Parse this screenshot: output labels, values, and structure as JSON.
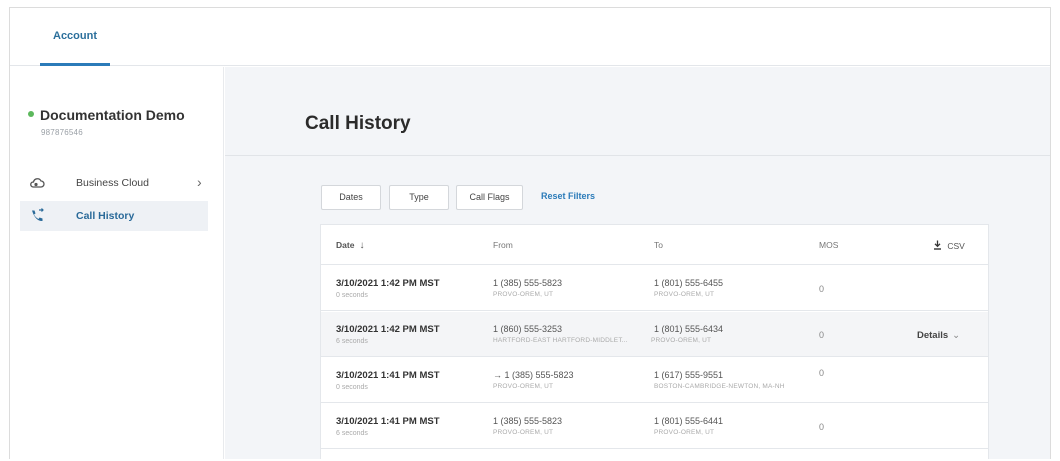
{
  "top_nav": {
    "tab_account": "Account"
  },
  "sidebar": {
    "account_name": "Documentation Demo",
    "account_id": "987876546",
    "items": [
      {
        "label": "Business Cloud",
        "icon": "cloud-icon",
        "chevron": "›"
      },
      {
        "label": "Call History",
        "icon": "phone-call-icon"
      }
    ]
  },
  "main": {
    "title": "Call History",
    "filters": {
      "dates": "Dates",
      "type": "Type",
      "call_flags": "Call Flags",
      "reset": "Reset Filters"
    },
    "table": {
      "headers": {
        "date": "Date",
        "from": "From",
        "to": "To",
        "mos": "MOS",
        "csv": "CSV"
      },
      "rows": [
        {
          "date": "3/10/2021 1:42 PM MST",
          "duration": "0 seconds",
          "from_number": "1 (385) 555-5823",
          "from_location": "PROVO-OREM, UT",
          "to_number": "1 (801) 555-6455",
          "to_location": "PROVO-OREM, UT",
          "mos": "0"
        },
        {
          "date": "3/10/2021 1:42 PM MST",
          "duration": "6 seconds",
          "from_number": "1 (860) 555-3253",
          "from_location": "HARTFORD-EAST HARTFORD-MIDDLET...",
          "to_number": "1 (801) 555-6434",
          "to_location": "PROVO-OREM, UT",
          "mos": "0",
          "details": "Details"
        },
        {
          "date": "3/10/2021 1:41 PM MST",
          "duration": "0 seconds",
          "from_number": "→ 1 (385) 555-5823",
          "from_location": "PROVO-OREM, UT",
          "to_number": "1 (617) 555-9551",
          "to_location": "BOSTON-CAMBRIDGE-NEWTON, MA-NH",
          "mos": "0"
        },
        {
          "date": "3/10/2021 1:41 PM MST",
          "duration": "6 seconds",
          "from_number": "1 (385) 555-5823",
          "from_location": "PROVO-OREM, UT",
          "to_number": "1 (801) 555-6441",
          "to_location": "PROVO-OREM, UT",
          "mos": "0"
        }
      ]
    }
  },
  "colors": {
    "accent": "#2b7bb9",
    "status_online": "#5cb85c",
    "main_bg": "#f3f5f8"
  }
}
